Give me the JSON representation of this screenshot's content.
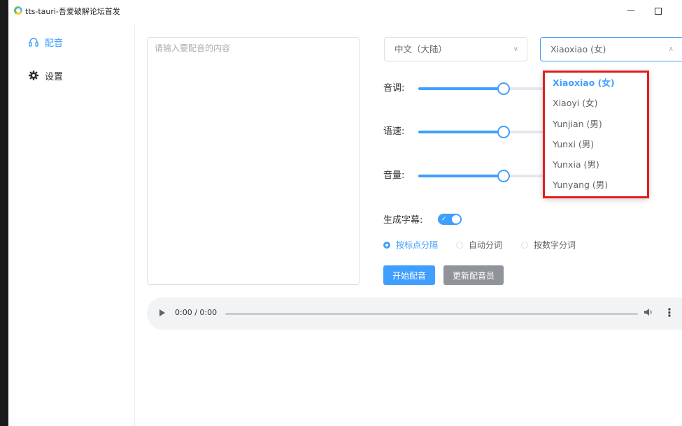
{
  "window": {
    "title": "tts-tauri-吾爱破解论坛首发",
    "minimize_glyph": "—",
    "controls": [
      "minimize",
      "maximize"
    ]
  },
  "sidebar": {
    "items": [
      {
        "label": "配音",
        "icon": "headphones-icon",
        "active": true
      },
      {
        "label": "设置",
        "icon": "gear-icon",
        "active": false
      }
    ]
  },
  "editor": {
    "placeholder": "请输入要配音的内容",
    "value": ""
  },
  "language_select": {
    "value": "中文（大陆）"
  },
  "voice_select": {
    "value": "Xiaoxiao (女)",
    "open": true,
    "options": [
      {
        "label": "Xiaoxiao (女)",
        "selected": true
      },
      {
        "label": "Xiaoyi (女)",
        "selected": false
      },
      {
        "label": "Yunjian (男)",
        "selected": false
      },
      {
        "label": "Yunxi (男)",
        "selected": false
      },
      {
        "label": "Yunxia (男)",
        "selected": false
      },
      {
        "label": "Yunyang (男)",
        "selected": false
      }
    ]
  },
  "sliders": {
    "pitch": {
      "label": "音调:",
      "fraction": 0.67
    },
    "rate": {
      "label": "语速:",
      "fraction": 0.67
    },
    "volume": {
      "label": "音量:",
      "fraction": 0.67
    }
  },
  "subtitle": {
    "label": "生成字幕:",
    "enabled": true
  },
  "split_mode": {
    "options": [
      {
        "label": "按标点分隔",
        "checked": true
      },
      {
        "label": "自动分词",
        "checked": false
      },
      {
        "label": "按数字分词",
        "checked": false
      }
    ]
  },
  "actions": {
    "start_label": "开始配音",
    "update_label": "更新配音员"
  },
  "audio": {
    "time": "0:00 / 0:00",
    "progress": 0
  },
  "colors": {
    "accent": "#409eff",
    "secondary_button": "#909399",
    "highlight_box": "#e01e1e"
  }
}
